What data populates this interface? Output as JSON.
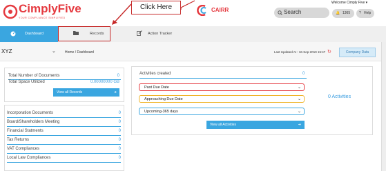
{
  "header": {
    "brand": "CimplyFive",
    "tagline": "YOUR COMPLIANCE SIMPLIFIED",
    "partner": "CAIRR",
    "callout": "Click Here",
    "search_placeholder": "Search",
    "welcome": "Welcome Cimply  Five",
    "notifications": "1365",
    "help": "Help"
  },
  "tabs": {
    "dashboard": "Dashboard",
    "records": "Records",
    "action_tracker": "Action Tracker"
  },
  "subbar": {
    "company": "XYZ",
    "breadcrumb": "Home  /  Dashboard",
    "last_updated": "Last Updated At : 16-Sep-2019 15:47",
    "company_data": "Company Data"
  },
  "summary": {
    "total_docs_label": "Total Number of Documents",
    "total_docs_value": "0",
    "space_label": "Total Space Utilized",
    "space_value": "0.00000000 GB",
    "view_all": "View all Records"
  },
  "categories": [
    {
      "label": "Incorporation Documents",
      "value": "0"
    },
    {
      "label": "Board/Shareholders Meeting",
      "value": "0"
    },
    {
      "label": "Financial Statments",
      "value": "0"
    },
    {
      "label": "Tax Returns",
      "value": "0"
    },
    {
      "label": "VAT Compliances",
      "value": "0"
    },
    {
      "label": "Local Law Compliances",
      "value": "0"
    }
  ],
  "activities": {
    "title": "Activities created",
    "count": "0",
    "filters": [
      "Past Due Date",
      "Approaching Due Date",
      "Upcoming-365 days"
    ],
    "summary": "0 Activities",
    "view_all": "View all Activities"
  },
  "colors": {
    "brand_red": "#e5393f",
    "accent_blue": "#3aa6e0",
    "highlight": "#c62828"
  }
}
